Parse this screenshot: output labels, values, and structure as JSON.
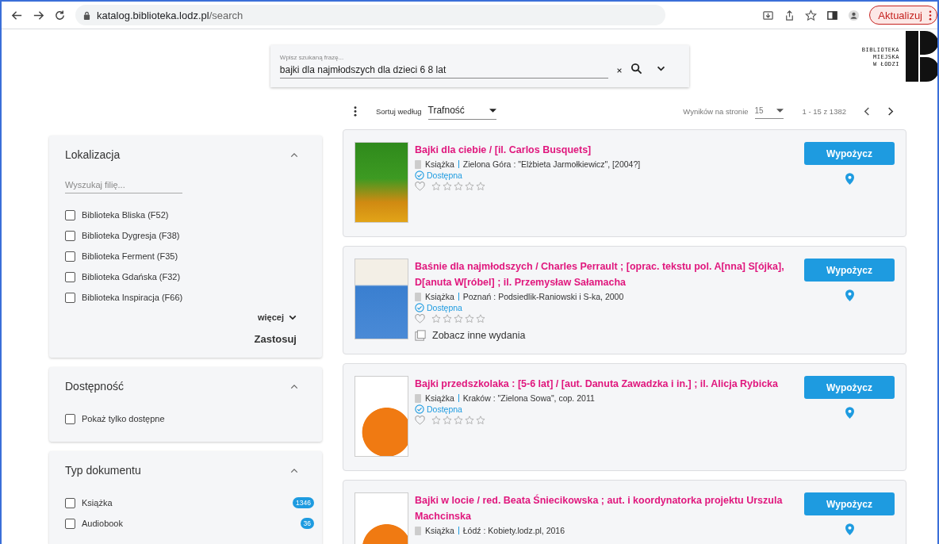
{
  "browser": {
    "url_host": "katalog.biblioteka.lodz.pl",
    "url_path": "/search",
    "update_button": "Aktualizuj"
  },
  "search": {
    "label": "Wpisz szukaną frazę...",
    "value": "bajki dla najmłodszych dla dzieci 6 8 lat"
  },
  "logo": {
    "lines": [
      "BIBLIOTEKA",
      "MIEJSKA",
      "W ŁODZI"
    ]
  },
  "toolbar": {
    "sort_label": "Sortuj według",
    "sort_value": "Trafność",
    "per_page_label": "Wyników na stronie",
    "per_page_value": "15",
    "range": "1 - 15 z 1382"
  },
  "filters": [
    {
      "title": "Lokalizacja",
      "expanded": true,
      "search_placeholder": "Wyszukaj filię...",
      "options": [
        {
          "label": "Biblioteka Bliska (F52)",
          "checked": false
        },
        {
          "label": "Biblioteka Dygresja (F38)",
          "checked": false
        },
        {
          "label": "Biblioteka Ferment (F35)",
          "checked": false
        },
        {
          "label": "Biblioteka Gdańska (F32)",
          "checked": false
        },
        {
          "label": "Biblioteka Inspiracja (F66)",
          "checked": false
        }
      ],
      "more": "więcej",
      "apply": "Zastosuj"
    },
    {
      "title": "Dostępność",
      "expanded": true,
      "options": [
        {
          "label": "Pokaż tylko dostępne",
          "checked": false
        }
      ]
    },
    {
      "title": "Typ dokumentu",
      "expanded": true,
      "options": [
        {
          "label": "Książka",
          "checked": false,
          "count": "1346"
        },
        {
          "label": "Audiobook",
          "checked": false,
          "count": "36"
        }
      ]
    }
  ],
  "results": [
    {
      "title": "Bajki dla ciebie / [il. Carlos Busquets]",
      "type": "Książka",
      "publisher": "Zielona Góra : \"Elżbieta Jarmołkiewicz\", [2004?]",
      "status": "Dostępna",
      "stars": 0,
      "button": "Wypożycz"
    },
    {
      "title": "Baśnie dla najmłodszych / Charles Perrault ; [oprac. tekstu pol. A[nna] S[ójka], D[anuta W[róbel] ; il. Przemysław Sałamacha",
      "type": "Książka",
      "publisher": "Poznań : Podsiedlik-Raniowski i S-ka, 2000",
      "status": "Dostępna",
      "stars": 0,
      "other_editions": "Zobacz inne wydania",
      "button": "Wypożycz"
    },
    {
      "title": "Bajki przedszkolaka : [5-6 lat] / [aut. Danuta Zawadzka i in.] ; il. Alicja Rybicka",
      "type": "Książka",
      "publisher": "Kraków : \"Zielona Sowa\", cop. 2011",
      "status": "Dostępna",
      "stars": 0,
      "button": "Wypożycz"
    },
    {
      "title": "Bajki w locie / red. Beata Śniecikowska ; aut. i koordynatorka projektu Urszula Machcinska",
      "type": "Książka",
      "publisher": "Łódź : Kobiety.lodz.pl, 2016",
      "button": "Wypożycz"
    }
  ]
}
